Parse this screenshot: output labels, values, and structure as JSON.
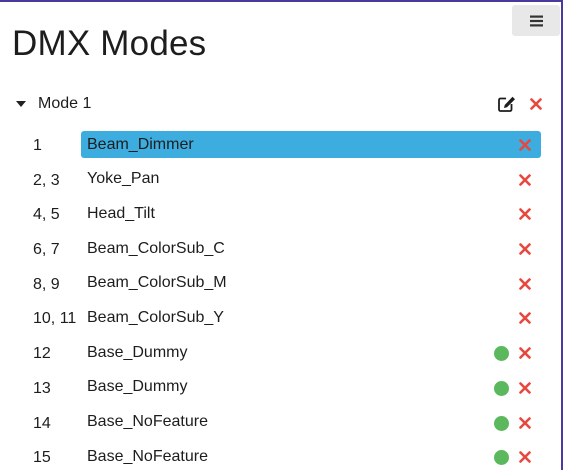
{
  "colors": {
    "accent_selected": "#3dade0",
    "remove_red": "#e8473e",
    "status_green": "#5cb85c",
    "frame_border": "#4b3a9c"
  },
  "toolbar": {
    "menu_icon": "hamburger-icon"
  },
  "page": {
    "title": "DMX Modes"
  },
  "mode": {
    "name": "Mode 1",
    "expanded": true,
    "edit_icon": "edit-icon",
    "delete_icon": "close-icon"
  },
  "channels": [
    {
      "number": "1",
      "name": "Beam_Dimmer",
      "selected": true,
      "status_dot": false
    },
    {
      "number": "2, 3",
      "name": "Yoke_Pan",
      "selected": false,
      "status_dot": false
    },
    {
      "number": "4, 5",
      "name": "Head_Tilt",
      "selected": false,
      "status_dot": false
    },
    {
      "number": "6, 7",
      "name": "Beam_ColorSub_C",
      "selected": false,
      "status_dot": false
    },
    {
      "number": "8, 9",
      "name": "Beam_ColorSub_M",
      "selected": false,
      "status_dot": false
    },
    {
      "number": "10, 11",
      "name": "Beam_ColorSub_Y",
      "selected": false,
      "status_dot": false
    },
    {
      "number": "12",
      "name": "Base_Dummy",
      "selected": false,
      "status_dot": true
    },
    {
      "number": "13",
      "name": "Base_Dummy",
      "selected": false,
      "status_dot": true
    },
    {
      "number": "14",
      "name": "Base_NoFeature",
      "selected": false,
      "status_dot": true
    },
    {
      "number": "15",
      "name": "Base_NoFeature",
      "selected": false,
      "status_dot": true
    }
  ]
}
